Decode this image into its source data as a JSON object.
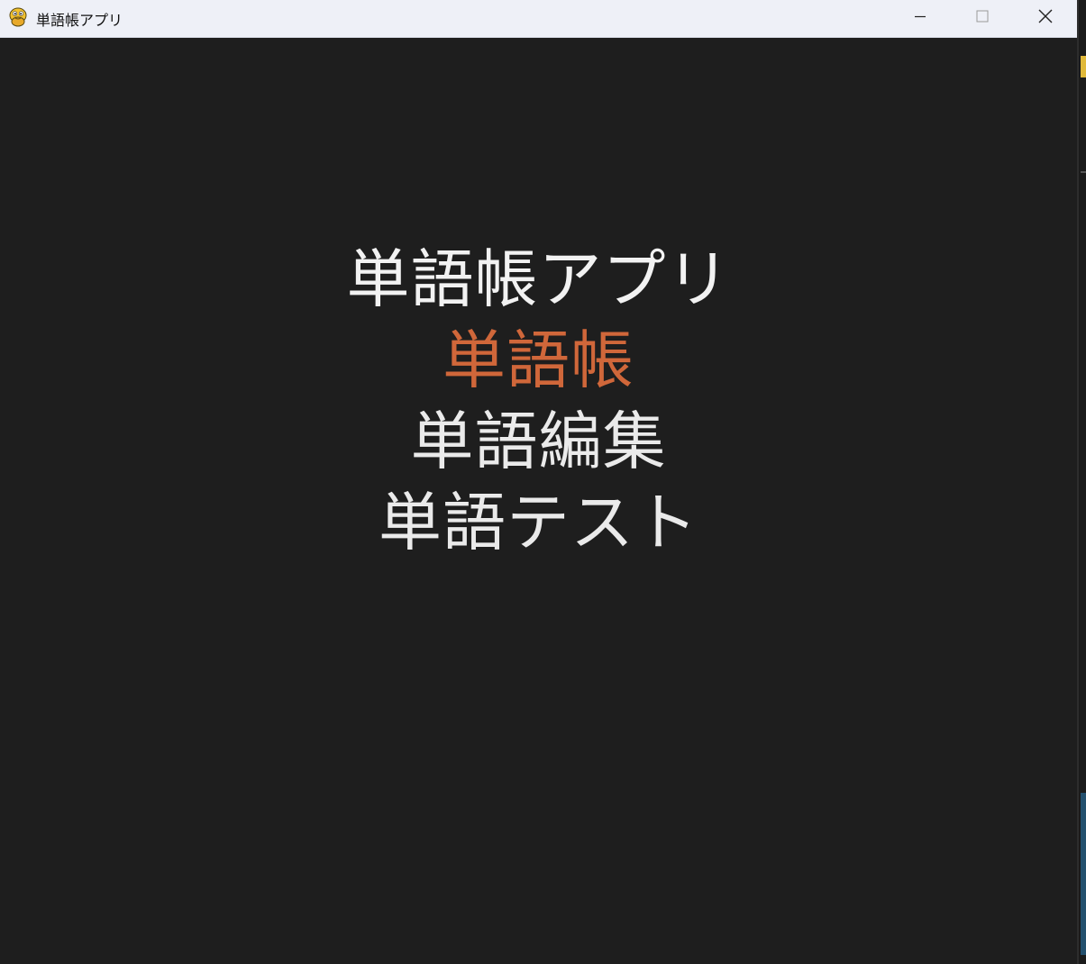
{
  "window": {
    "title": "単語帳アプリ",
    "icon": "python-snake-icon",
    "controls": {
      "minimize_icon": "minimize-icon",
      "maximize_icon": "maximize-icon",
      "close_icon": "close-icon"
    }
  },
  "menu": {
    "title": "単語帳アプリ",
    "items": [
      {
        "label": "単語帳",
        "selected": true,
        "color": "#d0673a"
      },
      {
        "label": "単語編集",
        "selected": false,
        "color": "#eaeaea"
      },
      {
        "label": "単語テスト",
        "selected": false,
        "color": "#eaeaea"
      }
    ]
  },
  "colors": {
    "background": "#1e1e1e",
    "titlebar": "#eef0f7",
    "text": "#f2f2f2",
    "accent": "#d0673a"
  }
}
